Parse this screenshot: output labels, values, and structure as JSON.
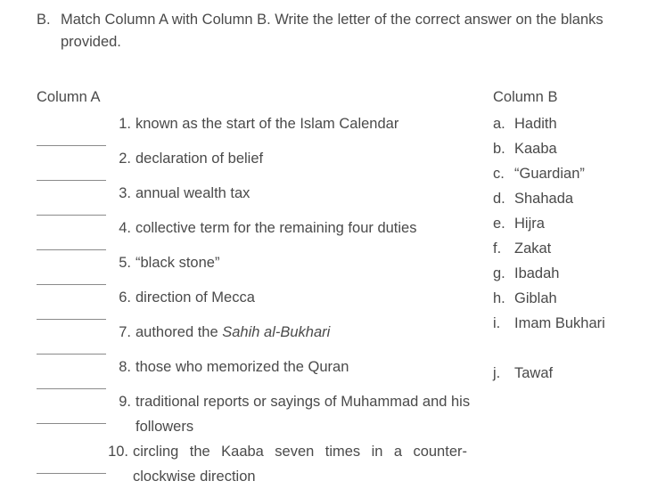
{
  "instruction": {
    "letter": "B.",
    "text": "Match Column A with Column B. Write the letter of the correct answer on the blanks provided."
  },
  "column_a": {
    "heading": "Column A",
    "items": [
      {
        "number": "1.",
        "text": "known as the start of the Islam Calendar"
      },
      {
        "number": "2.",
        "text": "declaration of belief"
      },
      {
        "number": "3.",
        "text": "annual wealth tax"
      },
      {
        "number": "4.",
        "text": "collective term for the remaining four duties"
      },
      {
        "number": "5.",
        "text": "“black stone”"
      },
      {
        "number": "6.",
        "text": "direction of Mecca"
      },
      {
        "number": "7.",
        "text": "authored the ",
        "italic": "Sahih al-Bukhari"
      },
      {
        "number": "8.",
        "text": "those who memorized the Quran"
      },
      {
        "number": "9.",
        "text": "traditional reports or sayings of Muhammad and his followers"
      },
      {
        "number": "10.",
        "text": "circling the Kaaba seven times in a counter-clockwise direction"
      }
    ]
  },
  "column_b": {
    "heading": "Column B",
    "items": [
      {
        "letter": "a.",
        "label": "Hadith"
      },
      {
        "letter": "b.",
        "label": "Kaaba"
      },
      {
        "letter": "c.",
        "label": "“Guardian”"
      },
      {
        "letter": "d.",
        "label": "Shahada"
      },
      {
        "letter": "e.",
        "label": "Hijra"
      },
      {
        "letter": "f.",
        "label": "Zakat"
      },
      {
        "letter": "g.",
        "label": "Ibadah"
      },
      {
        "letter": "h.",
        "label": "Giblah"
      },
      {
        "letter": "i.",
        "label": "Imam Bukhari"
      },
      {
        "letter": "j.",
        "label": "Tawaf"
      }
    ]
  },
  "colors": {
    "text": "#4a4a4a",
    "blank_line": "#8a8a8a",
    "background": "#ffffff"
  }
}
